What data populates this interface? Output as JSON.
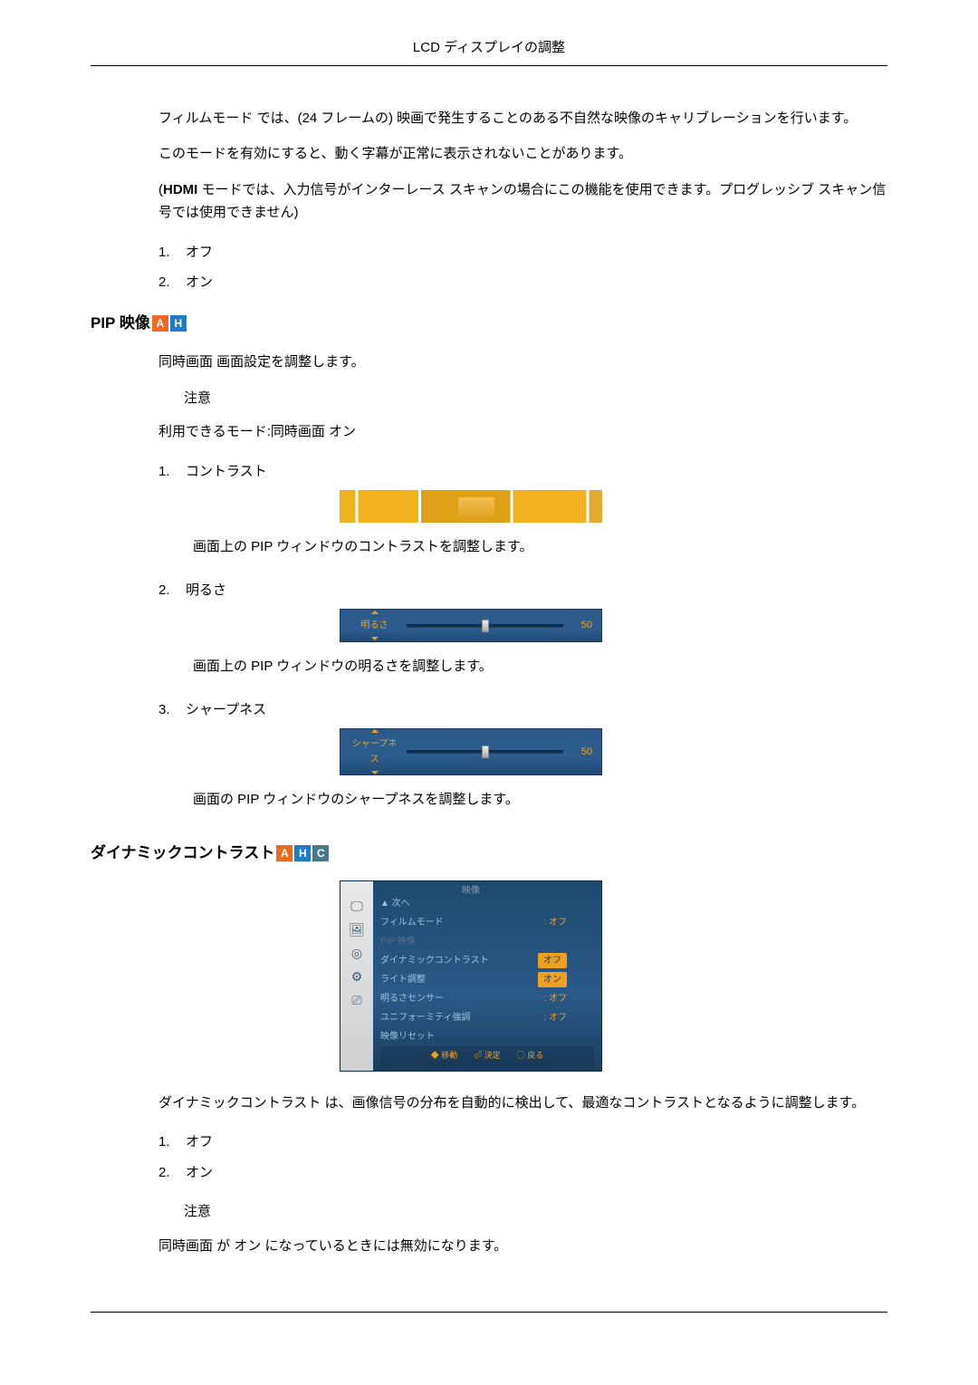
{
  "header": {
    "title": "LCD ディスプレイの調整"
  },
  "film": {
    "p1a": "フィルムモード",
    "p1b": " では、(24 フレームの) 映画で発生することのある不自然な映像のキャリブレーションを行います。",
    "p2": "このモードを有効にすると、動く字幕が正常に表示されないことがあります。",
    "p3a": "(",
    "p3b": "HDMI",
    "p3c": " モードでは、入力信号がインターレース スキャンの場合にこの機能を使用できます。プログレッシブ スキャン信号では使用できません)",
    "items": [
      {
        "n": "1.",
        "label": "オフ"
      },
      {
        "n": "2.",
        "label": "オン"
      }
    ]
  },
  "pip": {
    "title": "PIP 映像",
    "p1a": "同時画面",
    "p1b": " 画面設定を調整します。",
    "note_label": "注意",
    "p2a": "利用できるモード:",
    "p2b": "同時画面 オン",
    "items": [
      {
        "n": "1.",
        "label": "コントラスト",
        "desc": "画面上の PIP ウィンドウのコントラストを調整します。"
      },
      {
        "n": "2.",
        "label": "明るさ",
        "slider_label": "明るさ",
        "slider_val": "50",
        "desc": "画面上の PIP ウィンドウの明るさを調整します。"
      },
      {
        "n": "3.",
        "label": "シャープネス",
        "slider_label": "シャープネス",
        "slider_val": "50",
        "desc": "画面の PIP ウィンドウのシャープネスを調整します。"
      }
    ]
  },
  "dynamic": {
    "title": "ダイナミックコントラスト",
    "osd": {
      "title": "映像",
      "top": "▲ 次へ",
      "rows": [
        {
          "k": "フィルムモード",
          "v": ": オフ",
          "cls": ""
        },
        {
          "k": "PIP 映像",
          "v": "",
          "cls": "dim"
        },
        {
          "k": "ダイナミックコントラスト",
          "v": "オフ",
          "cls": "hl"
        },
        {
          "k": "ライト調整",
          "v": "オン",
          "cls": "hl"
        },
        {
          "k": "明るさセンサー",
          "v": ": オフ",
          "cls": ""
        },
        {
          "k": "ユニフォーミティ強調",
          "v": ": オフ",
          "cls": ""
        },
        {
          "k": "映像リセット",
          "v": "",
          "cls": ""
        }
      ],
      "footer": [
        "◆ 移動",
        "⏎ 決定",
        "◯ 戻る"
      ]
    },
    "p1a": "ダイナミックコントラスト",
    "p1b": " は、画像信号の分布を自動的に検出して、最適なコントラストとなるように調整します。",
    "items": [
      {
        "n": "1.",
        "label": "オフ"
      },
      {
        "n": "2.",
        "label": "オン"
      }
    ],
    "note_label": "注意",
    "p2a": "同時画面",
    "p2b": " が ",
    "p2c": "オン",
    "p2d": " になっているときには無効になります。"
  },
  "badges": {
    "a": "A",
    "h": "H",
    "c": "C"
  }
}
